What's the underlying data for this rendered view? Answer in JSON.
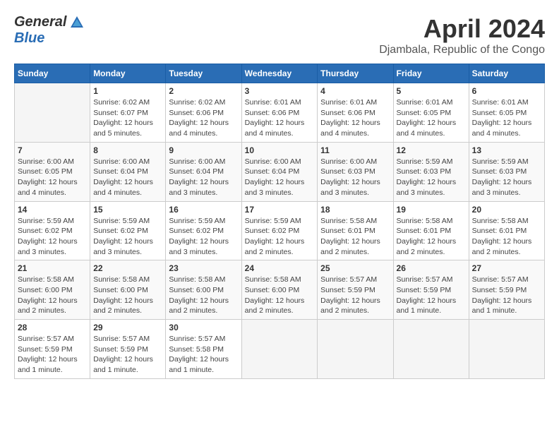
{
  "header": {
    "logo_general": "General",
    "logo_blue": "Blue",
    "month": "April 2024",
    "location": "Djambala, Republic of the Congo"
  },
  "days_of_week": [
    "Sunday",
    "Monday",
    "Tuesday",
    "Wednesday",
    "Thursday",
    "Friday",
    "Saturday"
  ],
  "weeks": [
    [
      {
        "day": "",
        "info": ""
      },
      {
        "day": "1",
        "info": "Sunrise: 6:02 AM\nSunset: 6:07 PM\nDaylight: 12 hours\nand 5 minutes."
      },
      {
        "day": "2",
        "info": "Sunrise: 6:02 AM\nSunset: 6:06 PM\nDaylight: 12 hours\nand 4 minutes."
      },
      {
        "day": "3",
        "info": "Sunrise: 6:01 AM\nSunset: 6:06 PM\nDaylight: 12 hours\nand 4 minutes."
      },
      {
        "day": "4",
        "info": "Sunrise: 6:01 AM\nSunset: 6:06 PM\nDaylight: 12 hours\nand 4 minutes."
      },
      {
        "day": "5",
        "info": "Sunrise: 6:01 AM\nSunset: 6:05 PM\nDaylight: 12 hours\nand 4 minutes."
      },
      {
        "day": "6",
        "info": "Sunrise: 6:01 AM\nSunset: 6:05 PM\nDaylight: 12 hours\nand 4 minutes."
      }
    ],
    [
      {
        "day": "7",
        "info": "Sunrise: 6:00 AM\nSunset: 6:05 PM\nDaylight: 12 hours\nand 4 minutes."
      },
      {
        "day": "8",
        "info": "Sunrise: 6:00 AM\nSunset: 6:04 PM\nDaylight: 12 hours\nand 4 minutes."
      },
      {
        "day": "9",
        "info": "Sunrise: 6:00 AM\nSunset: 6:04 PM\nDaylight: 12 hours\nand 3 minutes."
      },
      {
        "day": "10",
        "info": "Sunrise: 6:00 AM\nSunset: 6:04 PM\nDaylight: 12 hours\nand 3 minutes."
      },
      {
        "day": "11",
        "info": "Sunrise: 6:00 AM\nSunset: 6:03 PM\nDaylight: 12 hours\nand 3 minutes."
      },
      {
        "day": "12",
        "info": "Sunrise: 5:59 AM\nSunset: 6:03 PM\nDaylight: 12 hours\nand 3 minutes."
      },
      {
        "day": "13",
        "info": "Sunrise: 5:59 AM\nSunset: 6:03 PM\nDaylight: 12 hours\nand 3 minutes."
      }
    ],
    [
      {
        "day": "14",
        "info": "Sunrise: 5:59 AM\nSunset: 6:02 PM\nDaylight: 12 hours\nand 3 minutes."
      },
      {
        "day": "15",
        "info": "Sunrise: 5:59 AM\nSunset: 6:02 PM\nDaylight: 12 hours\nand 3 minutes."
      },
      {
        "day": "16",
        "info": "Sunrise: 5:59 AM\nSunset: 6:02 PM\nDaylight: 12 hours\nand 3 minutes."
      },
      {
        "day": "17",
        "info": "Sunrise: 5:59 AM\nSunset: 6:02 PM\nDaylight: 12 hours\nand 2 minutes."
      },
      {
        "day": "18",
        "info": "Sunrise: 5:58 AM\nSunset: 6:01 PM\nDaylight: 12 hours\nand 2 minutes."
      },
      {
        "day": "19",
        "info": "Sunrise: 5:58 AM\nSunset: 6:01 PM\nDaylight: 12 hours\nand 2 minutes."
      },
      {
        "day": "20",
        "info": "Sunrise: 5:58 AM\nSunset: 6:01 PM\nDaylight: 12 hours\nand 2 minutes."
      }
    ],
    [
      {
        "day": "21",
        "info": "Sunrise: 5:58 AM\nSunset: 6:00 PM\nDaylight: 12 hours\nand 2 minutes."
      },
      {
        "day": "22",
        "info": "Sunrise: 5:58 AM\nSunset: 6:00 PM\nDaylight: 12 hours\nand 2 minutes."
      },
      {
        "day": "23",
        "info": "Sunrise: 5:58 AM\nSunset: 6:00 PM\nDaylight: 12 hours\nand 2 minutes."
      },
      {
        "day": "24",
        "info": "Sunrise: 5:58 AM\nSunset: 6:00 PM\nDaylight: 12 hours\nand 2 minutes."
      },
      {
        "day": "25",
        "info": "Sunrise: 5:57 AM\nSunset: 5:59 PM\nDaylight: 12 hours\nand 2 minutes."
      },
      {
        "day": "26",
        "info": "Sunrise: 5:57 AM\nSunset: 5:59 PM\nDaylight: 12 hours\nand 1 minute."
      },
      {
        "day": "27",
        "info": "Sunrise: 5:57 AM\nSunset: 5:59 PM\nDaylight: 12 hours\nand 1 minute."
      }
    ],
    [
      {
        "day": "28",
        "info": "Sunrise: 5:57 AM\nSunset: 5:59 PM\nDaylight: 12 hours\nand 1 minute."
      },
      {
        "day": "29",
        "info": "Sunrise: 5:57 AM\nSunset: 5:59 PM\nDaylight: 12 hours\nand 1 minute."
      },
      {
        "day": "30",
        "info": "Sunrise: 5:57 AM\nSunset: 5:58 PM\nDaylight: 12 hours\nand 1 minute."
      },
      {
        "day": "",
        "info": ""
      },
      {
        "day": "",
        "info": ""
      },
      {
        "day": "",
        "info": ""
      },
      {
        "day": "",
        "info": ""
      }
    ]
  ]
}
